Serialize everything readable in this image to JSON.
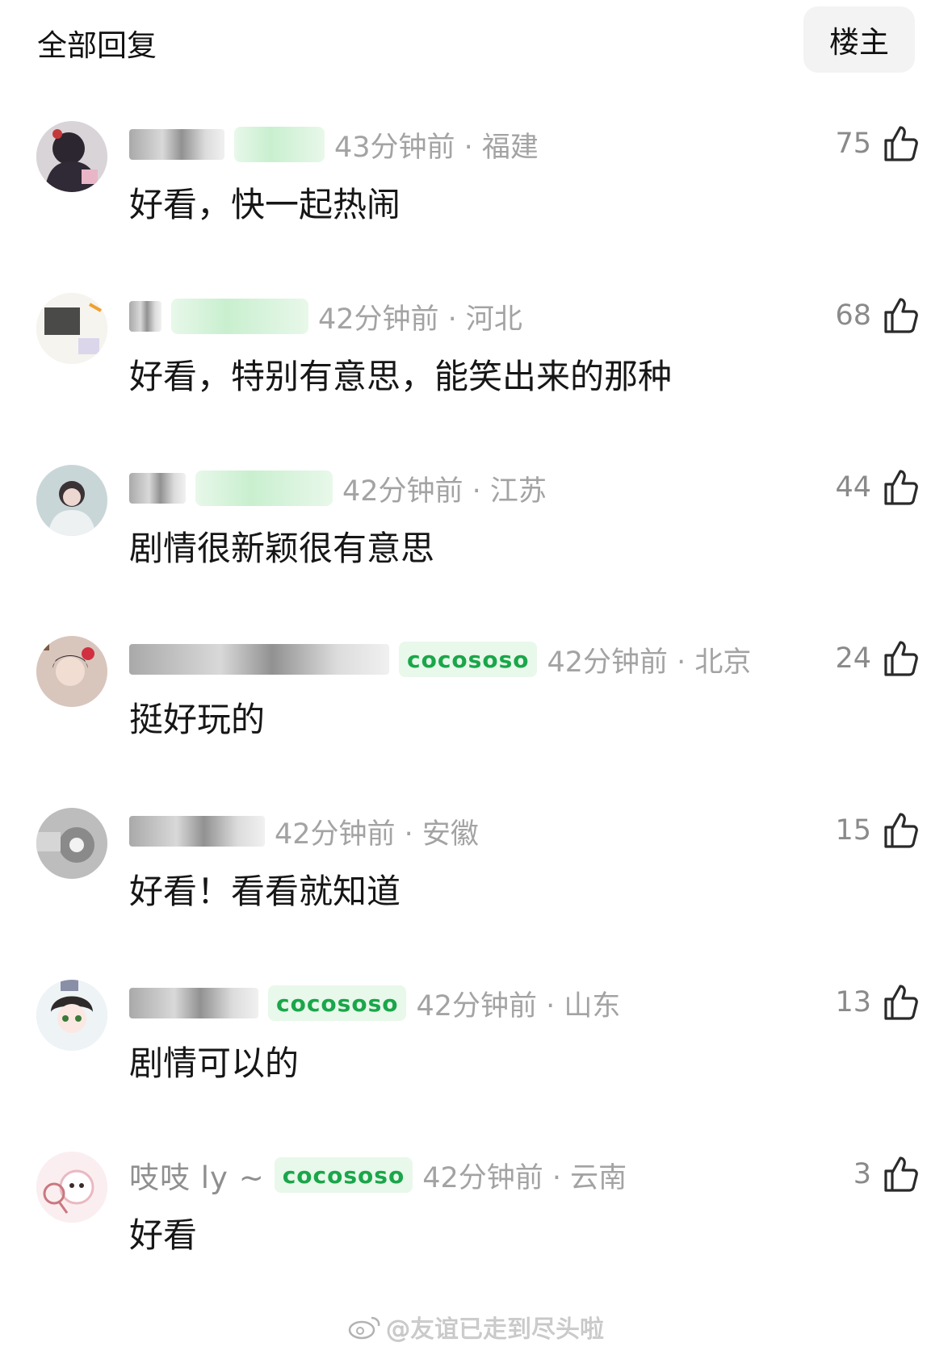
{
  "header": {
    "title": "全部回复",
    "owner_filter_label": "楼主"
  },
  "comments": [
    {
      "username": "",
      "username_blurred": true,
      "badge": "",
      "time_region": "43分钟前 · 福建",
      "text": "好看，快一起热闹",
      "likes": "75"
    },
    {
      "username": "",
      "username_blurred": true,
      "badge": "",
      "time_region": "42分钟前 · 河北",
      "text": "好看，特别有意思，能笑出来的那种",
      "likes": "68"
    },
    {
      "username": "",
      "username_blurred": true,
      "badge": "",
      "time_region": "42分钟前 · 江苏",
      "text": "剧情很新颖很有意思",
      "likes": "44"
    },
    {
      "username": "",
      "username_blurred": true,
      "badge": "cocososo",
      "time_region": "42分钟前 · 北京",
      "text": "挺好玩的",
      "likes": "24"
    },
    {
      "username": "",
      "username_blurred": true,
      "badge": "",
      "time_region": "42分钟前 · 安徽",
      "text": "好看！看看就知道",
      "likes": "15"
    },
    {
      "username": "",
      "username_blurred": true,
      "badge": "cocososo",
      "time_region": "42分钟前 · 山东",
      "text": "剧情可以的",
      "likes": "13"
    },
    {
      "username": "吱吱 ly ~",
      "username_blurred": false,
      "badge": "cocososo",
      "time_region": "42分钟前 · 云南",
      "text": "好看",
      "likes": "3"
    }
  ],
  "watermark": {
    "text": "@友谊已走到尽头啦",
    "icon": "weibo-icon"
  },
  "colors": {
    "badge_text": "#1aa64a",
    "badge_bg": "#e8f8ea",
    "meta_gray": "#a3a3a3",
    "owner_button_bg": "#f3f3f3"
  }
}
